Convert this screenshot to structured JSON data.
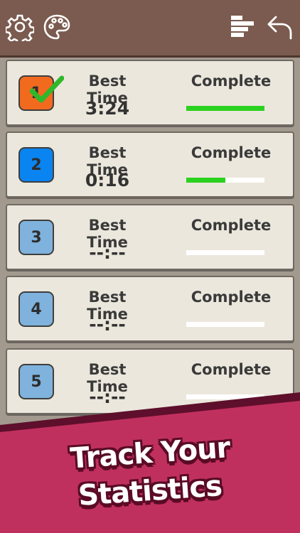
{
  "toolbar": {
    "settings_icon": "gear-icon",
    "theme_icon": "palette-icon",
    "stats_icon": "bar-chart-icon",
    "back_icon": "undo-arrow-icon"
  },
  "levels": [
    {
      "number": "1",
      "best_label": "Best Time",
      "time": "3:24",
      "complete_label": "Complete",
      "progress": 1.0,
      "badge_color": "#f26a1e",
      "completed": true
    },
    {
      "number": "2",
      "best_label": "Best Time",
      "time": "0:16",
      "complete_label": "Complete",
      "progress": 0.5,
      "badge_color": "#0a84f0",
      "completed": false
    },
    {
      "number": "3",
      "best_label": "Best Time",
      "time": "--:--",
      "complete_label": "Complete",
      "progress": 0,
      "badge_color": "#7fb2dc",
      "completed": false
    },
    {
      "number": "4",
      "best_label": "Best Time",
      "time": "--:--",
      "complete_label": "Complete",
      "progress": 0,
      "badge_color": "#7fb2dc",
      "completed": false
    },
    {
      "number": "5",
      "best_label": "Best Time",
      "time": "--:--",
      "complete_label": "Complete",
      "progress": 0,
      "badge_color": "#7fb2dc",
      "completed": false
    }
  ],
  "banner": {
    "line1": "Track Your",
    "line2": "Statistics",
    "color": "#c0305f"
  },
  "colors": {
    "topbar": "#7b5b4f",
    "progress_fill": "#2ad21f",
    "check": "#2fb82a"
  }
}
